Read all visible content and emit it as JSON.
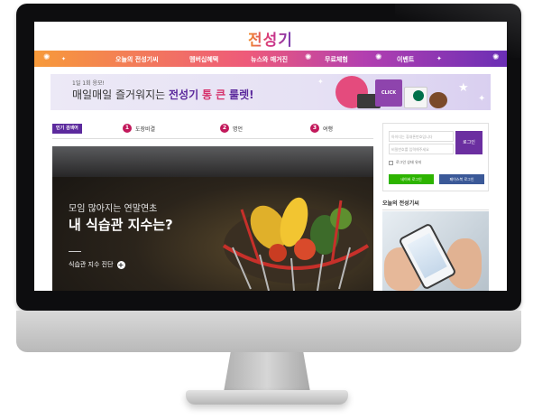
{
  "site": {
    "logo": "전성기"
  },
  "nav": {
    "items": [
      "오늘의 전성기씨",
      "멤버십혜택",
      "뉴스와 매거진",
      "무료체험",
      "이벤트"
    ]
  },
  "banner": {
    "small_text": "1일 1회 응모!",
    "main_prefix": "매일매일 즐거워지는 ",
    "main_brand": "전성기",
    "main_highlight": "통 큰",
    "main_suffix": "룰렛!",
    "badge_text": "CLICK"
  },
  "hot_keywords": {
    "label": "인기 검색어",
    "items": [
      {
        "rank": "1",
        "label": "도장비결"
      },
      {
        "rank": "2",
        "label": "명언"
      },
      {
        "rank": "3",
        "label": "여행"
      }
    ]
  },
  "hero": {
    "subtitle": "모임 많아지는 연말연초",
    "title": "내 식습관 지수는?",
    "link_label": "식습관 지수 진단",
    "link_icon": "plus-circle-icon"
  },
  "login": {
    "id_placeholder": "아이디는 휴대폰번호입니다",
    "pw_placeholder": "비밀번호를 입력해주세요",
    "button_label": "로그인",
    "keep_label": "로그인 상태 유지",
    "naver_label": "네이버 로그인",
    "facebook_label": "페이스북 로그인"
  },
  "today": {
    "title": "오늘의 전성기씨"
  },
  "colors": {
    "brand_purple": "#5c2a9d",
    "rank_pink": "#c2185b",
    "naver_green": "#2db400",
    "facebook_blue": "#3b5998"
  }
}
